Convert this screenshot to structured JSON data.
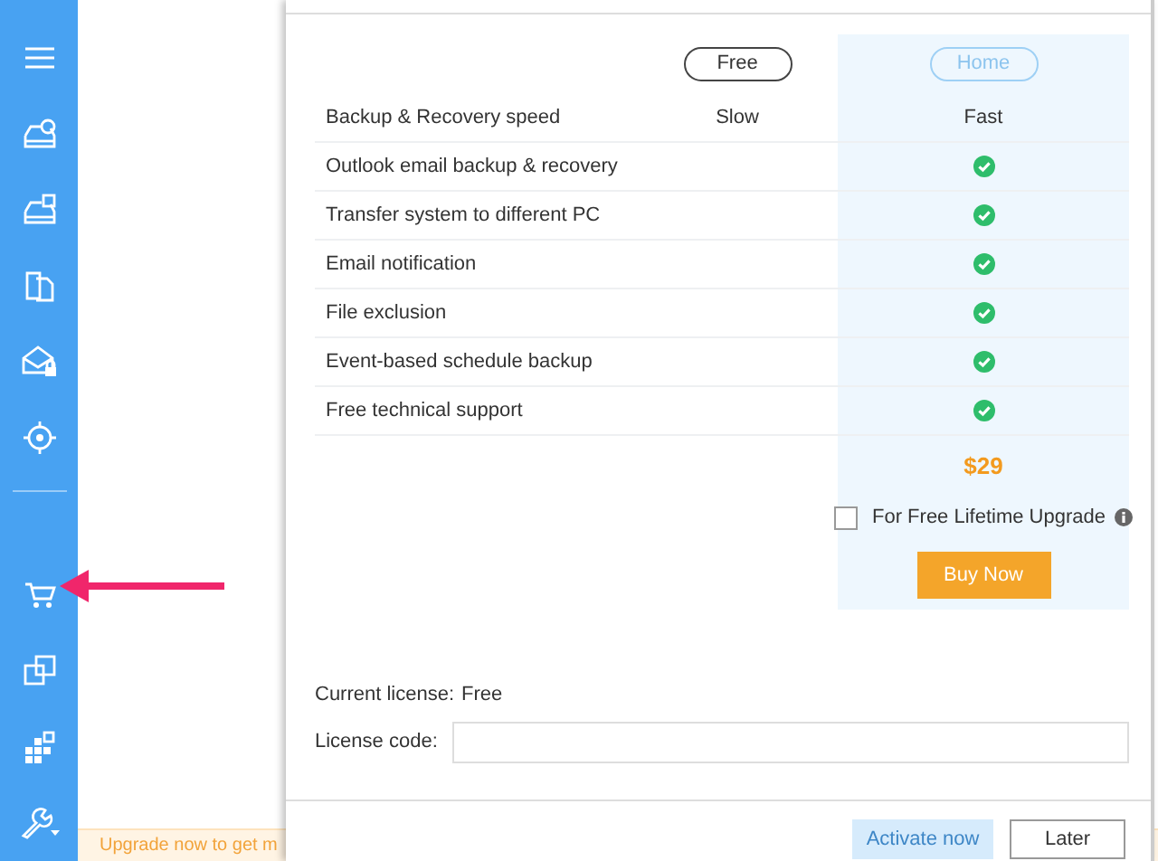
{
  "banner": {
    "text": "Upgrade now to get m"
  },
  "dialog": {
    "plans": [
      {
        "label": "Free",
        "selected": false
      },
      {
        "label": "Home",
        "selected": true
      }
    ],
    "features": [
      {
        "name": "Backup & Recovery speed",
        "free": {
          "kind": "text",
          "text": "Slow"
        },
        "home": {
          "kind": "text",
          "text": "Fast"
        }
      },
      {
        "name": "Outlook email backup & recovery",
        "home": {
          "kind": "check"
        }
      },
      {
        "name": "Transfer system to different PC",
        "home": {
          "kind": "check"
        }
      },
      {
        "name": "Email notification",
        "home": {
          "kind": "check"
        }
      },
      {
        "name": "File exclusion",
        "home": {
          "kind": "check"
        }
      },
      {
        "name": "Event-based schedule backup",
        "home": {
          "kind": "check"
        }
      },
      {
        "name": "Free technical support",
        "home": {
          "kind": "check"
        }
      }
    ],
    "price": "$29",
    "lifetime_upgrade": {
      "label": "For Free Lifetime Upgrade",
      "checked": false
    },
    "buy_button": "Buy Now",
    "current_license": {
      "label": "Current license:",
      "value": "Free"
    },
    "license_code": {
      "label": "License code:"
    },
    "buttons": [
      {
        "label": "Activate now",
        "disabled": true
      },
      {
        "label": "Later",
        "disabled": false
      }
    ]
  }
}
